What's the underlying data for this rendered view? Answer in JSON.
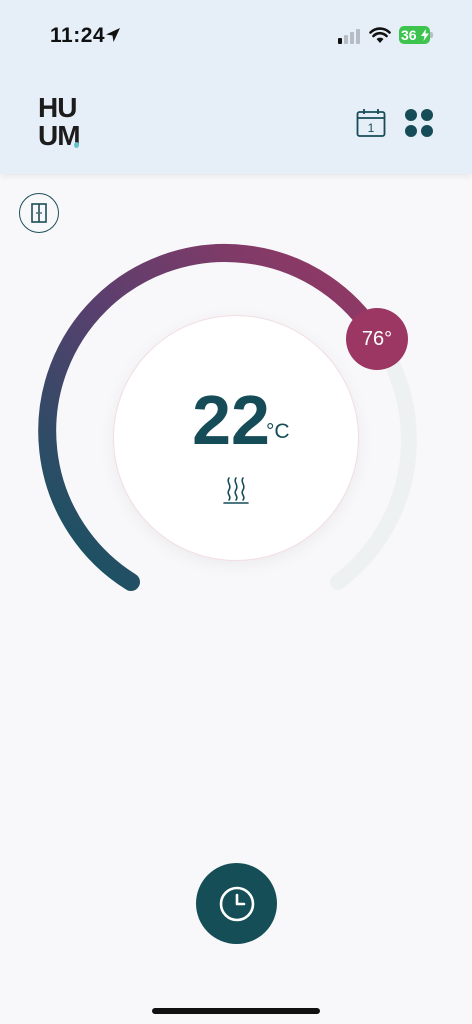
{
  "status_bar": {
    "time": "11:24",
    "battery_level": "36",
    "battery_color": "#3dc44f",
    "location_icon": "location-arrow-icon",
    "signal_icon": "cellular-signal-icon",
    "wifi_icon": "wifi-icon"
  },
  "header": {
    "logo": {
      "line1": "HU",
      "line2": "UM"
    },
    "calendar": {
      "icon": "calendar-icon",
      "day": "1"
    },
    "menu": {
      "icon": "grid-menu-icon"
    },
    "background": "#e6eef7"
  },
  "door": {
    "icon": "door-icon"
  },
  "thermostat": {
    "current_temperature": "22",
    "unit": "°C",
    "target_temperature": "76°",
    "heating_icon": "heat-waves-icon",
    "arc_gradient": [
      "#0f5560",
      "#5a3f6e",
      "#9c3763"
    ],
    "text_color": "#164c57",
    "badge_color": "#9c3763"
  },
  "timer": {
    "icon": "clock-icon",
    "color": "#154e56"
  }
}
